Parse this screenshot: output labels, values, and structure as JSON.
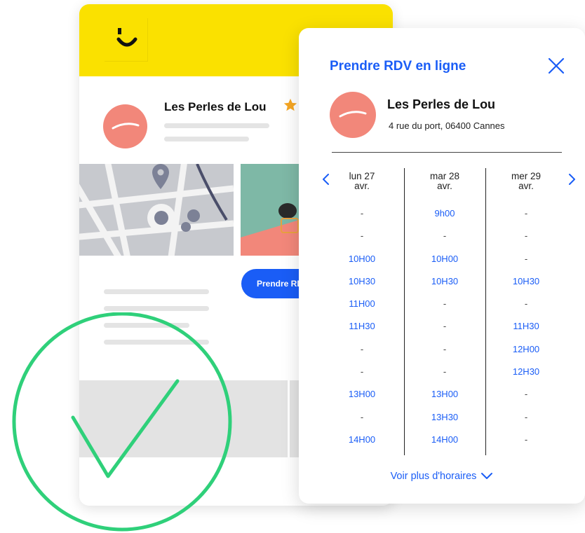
{
  "colors": {
    "brand_yellow": "#FAE100",
    "accent_blue": "#1A5DF6",
    "salon_coral": "#F2877A",
    "success_green": "#2FD07A",
    "star_gold": "#F5A623"
  },
  "background_card": {
    "business_name": "Les Perles de Lou",
    "button_label": "Prendre RDV en ligne",
    "icons": [
      "logo-smile-icon",
      "star-icon",
      "map-pin-icon"
    ]
  },
  "modal": {
    "title": "Prendre RDV en ligne",
    "business_name": "Les Perles de Lou",
    "address": "4 rue du port, 06400 Cannes",
    "more_label": "Voir plus d'horaires",
    "days": [
      {
        "label_line1": "lun 27",
        "label_line2": "avr.",
        "slots": [
          "-",
          "-",
          "10H00",
          "10H30",
          "11H00",
          "11H30",
          "-",
          "-",
          "13H00",
          "-",
          "14H00"
        ]
      },
      {
        "label_line1": "mar 28",
        "label_line2": "avr.",
        "slots": [
          "9h00",
          "-",
          "10H00",
          "10H30",
          "-",
          "-",
          "-",
          "-",
          "13H00",
          "13H30",
          "14H00"
        ]
      },
      {
        "label_line1": "mer 29",
        "label_line2": "avr.",
        "slots": [
          "-",
          "-",
          "-",
          "10H30",
          "-",
          "11H30",
          "12H00",
          "12H30",
          "-",
          "-",
          "-"
        ]
      }
    ]
  },
  "success_overlay": {
    "icon": "checkmark-circle-icon"
  }
}
